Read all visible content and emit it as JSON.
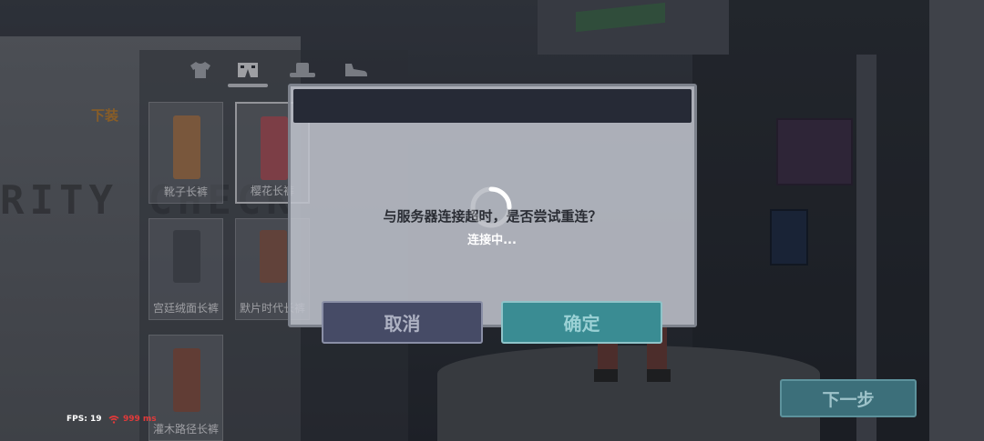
{
  "background": {
    "wall_text": "RITY CHECK"
  },
  "wardrobe": {
    "category_tabs": [
      {
        "icon": "tshirt-icon",
        "selected": false
      },
      {
        "icon": "pants-icon",
        "selected": true
      },
      {
        "icon": "hat-icon",
        "selected": false
      },
      {
        "icon": "shoe-icon",
        "selected": false
      }
    ],
    "side_label": "下装",
    "items": [
      {
        "label": "靴子长裤",
        "color": "#b07a4e",
        "selected": false
      },
      {
        "label": "樱花长裤",
        "color": "#b4545c",
        "selected": true
      },
      {
        "label": "宫廷绒面长裤",
        "color": "#4c4f56",
        "selected": false
      },
      {
        "label": "默片时代长裤",
        "color": "#8b5a4a",
        "selected": false
      },
      {
        "label": "灌木路径长裤",
        "color": "#8a5242",
        "selected": false
      }
    ]
  },
  "hud": {
    "fps": "FPS: 19",
    "ping": "999 ms",
    "ping_color": "#e23a3a"
  },
  "next_button": "下一步",
  "dialog": {
    "message": "与服务器连接超时，是否尝试重连？",
    "cancel_label": "取消",
    "confirm_label": "确定"
  },
  "loading": {
    "text": "连接中..."
  },
  "colors": {
    "accent_teal": "#3a8c93",
    "dialog_header": "#262a36",
    "label_orange": "#c7832d"
  }
}
